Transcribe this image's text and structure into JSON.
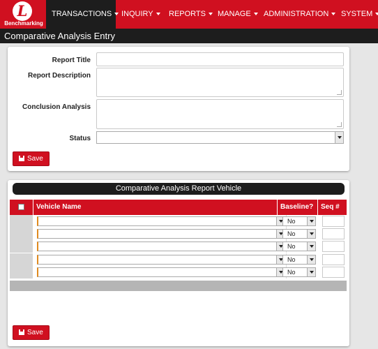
{
  "nav": {
    "logo_text": "Benchmarking",
    "items": [
      {
        "label": "TRANSACTIONS"
      },
      {
        "label": "INQUIRY"
      },
      {
        "label": "REPORTS"
      },
      {
        "label": "MANAGE"
      },
      {
        "label": "ADMINISTRATION"
      },
      {
        "label": "SYSTEM"
      }
    ]
  },
  "page": {
    "title": "Comparative Analysis Entry"
  },
  "form": {
    "report_title_label": "Report Title",
    "report_title_value": "",
    "report_description_label": "Report Description",
    "report_description_value": "",
    "conclusion_label": "Conclusion Analysis",
    "conclusion_value": "",
    "status_label": "Status",
    "status_value": "",
    "save_label": "Save"
  },
  "vehicles": {
    "section_title": "Comparative Analysis Report Vehicle",
    "columns": {
      "vehicle_name": "Vehicle Name",
      "baseline": "Baseline?",
      "seq": "Seq #"
    },
    "rows": [
      {
        "vehicle": "",
        "baseline": "No",
        "seq": ""
      },
      {
        "vehicle": "",
        "baseline": "No",
        "seq": ""
      },
      {
        "vehicle": "",
        "baseline": "No",
        "seq": ""
      },
      {
        "vehicle": "",
        "baseline": "No",
        "seq": ""
      },
      {
        "vehicle": "",
        "baseline": "No",
        "seq": ""
      }
    ],
    "save_label": "Save"
  },
  "colors": {
    "brand_red": "#d01020",
    "nav_dark": "#1d1d1d",
    "accent_orange": "#e08a1e"
  }
}
